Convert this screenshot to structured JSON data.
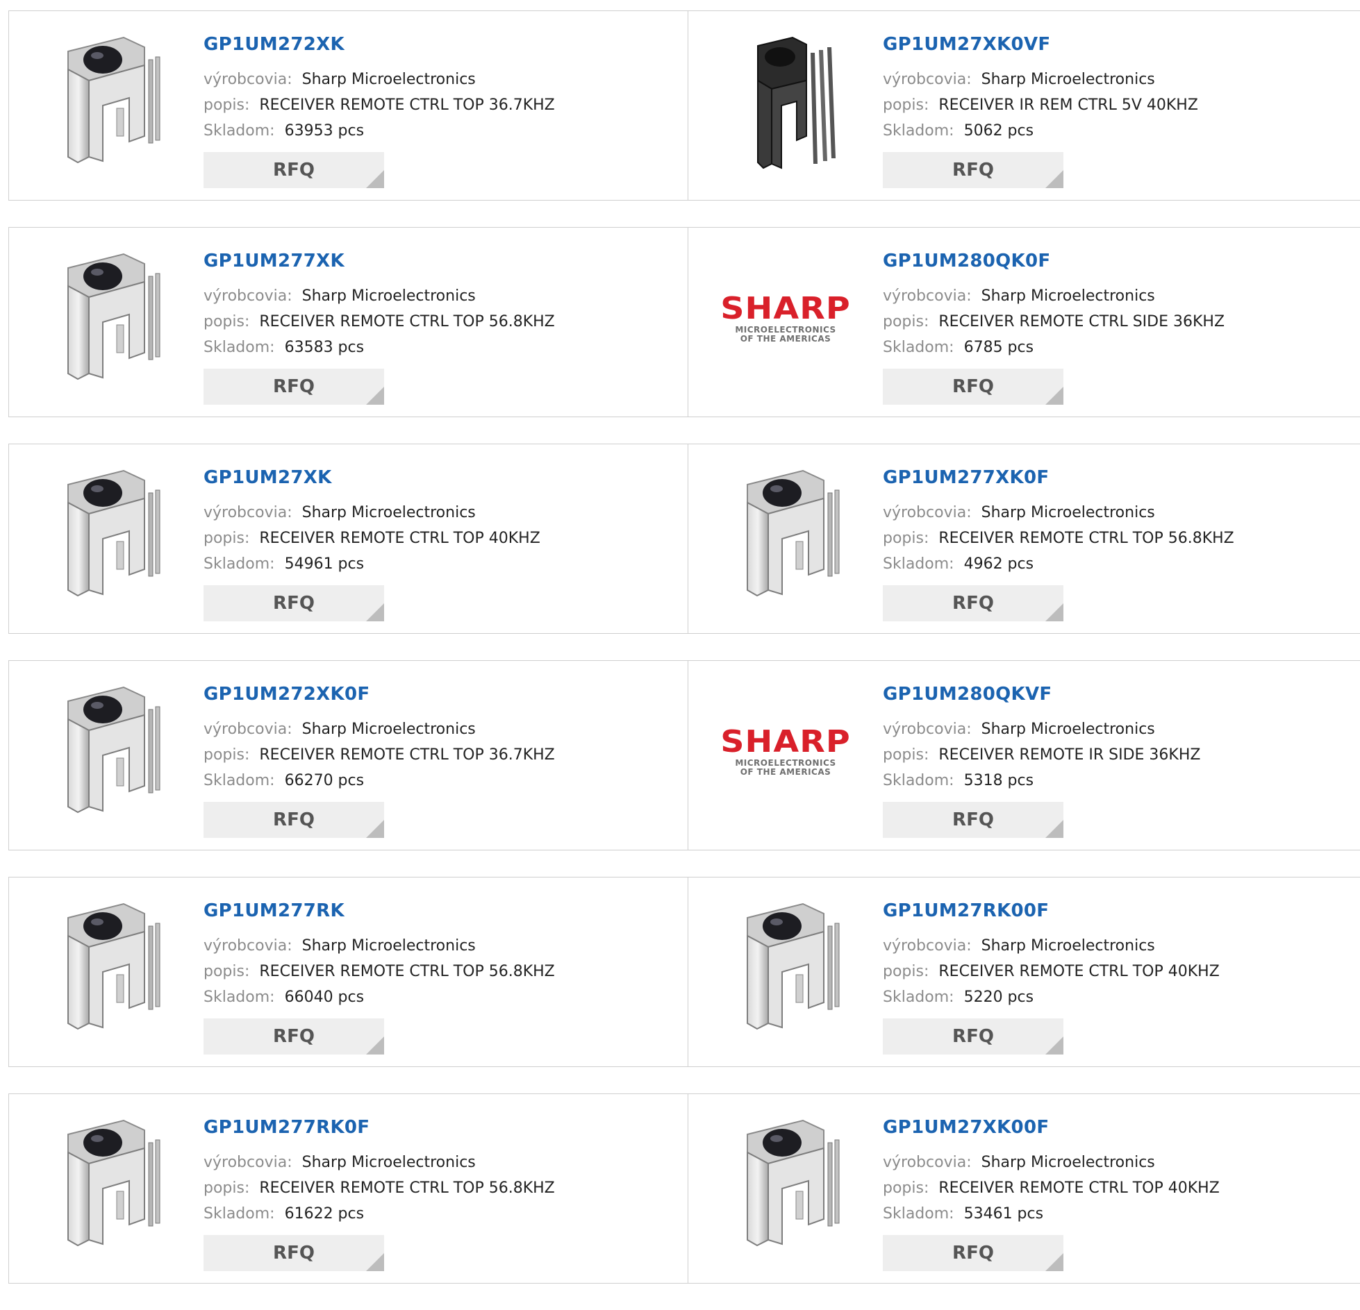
{
  "labels": {
    "manufacturer": "výrobcovia:",
    "description": "popis:",
    "stock": "Skladom:",
    "rfq": "RFQ"
  },
  "logo": {
    "word": "SHARP",
    "line1": "MICROELECTRONICS",
    "line2": "OF THE AMERICAS"
  },
  "colors": {
    "title": "#1b63b0",
    "label": "#8b8b8b",
    "rfq_bg": "#eeeeee",
    "logo_red": "#d9202a"
  },
  "products": [
    {
      "part": "GP1UM272XK",
      "manufacturer": "Sharp Microelectronics",
      "description": "RECEIVER REMOTE CTRL TOP 36.7KHZ",
      "stock": "63953 pcs",
      "image": "ir-receiver-metal-icon"
    },
    {
      "part": "GP1UM27XK0VF",
      "manufacturer": "Sharp Microelectronics",
      "description": "RECEIVER IR REM CTRL 5V 40KHZ",
      "stock": "5062 pcs",
      "image": "ir-receiver-black-icon"
    },
    {
      "part": "GP1UM277XK",
      "manufacturer": "Sharp Microelectronics",
      "description": "RECEIVER REMOTE CTRL TOP 56.8KHZ",
      "stock": "63583 pcs",
      "image": "ir-receiver-metal-icon"
    },
    {
      "part": "GP1UM280QK0F",
      "manufacturer": "Sharp Microelectronics",
      "description": "RECEIVER REMOTE CTRL SIDE 36KHZ",
      "stock": "6785 pcs",
      "image": "sharp-logo"
    },
    {
      "part": "GP1UM27XK",
      "manufacturer": "Sharp Microelectronics",
      "description": "RECEIVER REMOTE CTRL TOP 40KHZ",
      "stock": "54961 pcs",
      "image": "ir-receiver-metal-icon"
    },
    {
      "part": "GP1UM277XK0F",
      "manufacturer": "Sharp Microelectronics",
      "description": "RECEIVER REMOTE CTRL TOP 56.8KHZ",
      "stock": "4962 pcs",
      "image": "ir-receiver-metal-icon"
    },
    {
      "part": "GP1UM272XK0F",
      "manufacturer": "Sharp Microelectronics",
      "description": "RECEIVER REMOTE CTRL TOP 36.7KHZ",
      "stock": "66270 pcs",
      "image": "ir-receiver-metal-icon"
    },
    {
      "part": "GP1UM280QKVF",
      "manufacturer": "Sharp Microelectronics",
      "description": "RECEIVER REMOTE IR SIDE 36KHZ",
      "stock": "5318 pcs",
      "image": "sharp-logo"
    },
    {
      "part": "GP1UM277RK",
      "manufacturer": "Sharp Microelectronics",
      "description": "RECEIVER REMOTE CTRL TOP 56.8KHZ",
      "stock": "66040 pcs",
      "image": "ir-receiver-metal-icon"
    },
    {
      "part": "GP1UM27RK00F",
      "manufacturer": "Sharp Microelectronics",
      "description": "RECEIVER REMOTE CTRL TOP 40KHZ",
      "stock": "5220 pcs",
      "image": "ir-receiver-metal-icon"
    },
    {
      "part": "GP1UM277RK0F",
      "manufacturer": "Sharp Microelectronics",
      "description": "RECEIVER REMOTE CTRL TOP 56.8KHZ",
      "stock": "61622 pcs",
      "image": "ir-receiver-metal-icon"
    },
    {
      "part": "GP1UM27XK00F",
      "manufacturer": "Sharp Microelectronics",
      "description": "RECEIVER REMOTE CTRL TOP 40KHZ",
      "stock": "53461 pcs",
      "image": "ir-receiver-metal-icon"
    }
  ]
}
